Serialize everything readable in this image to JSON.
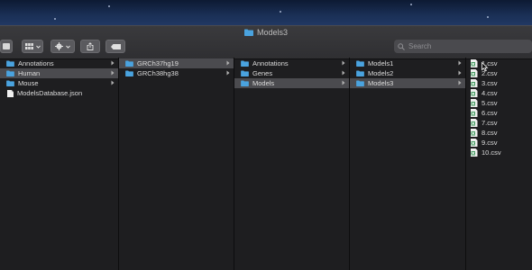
{
  "window": {
    "title": "Models3"
  },
  "toolbar": {
    "search_placeholder": "Search",
    "buttons": [
      "sidebar-toggle-button",
      "view-options-button",
      "action-gear-button",
      "share-button",
      "tag-button"
    ]
  },
  "columns": [
    {
      "items": [
        {
          "label": "Annotations",
          "type": "folder",
          "chevron": true,
          "selected": false
        },
        {
          "label": "Human",
          "type": "folder",
          "chevron": true,
          "selected": true
        },
        {
          "label": "Mouse",
          "type": "folder",
          "chevron": true,
          "selected": false
        },
        {
          "label": "ModelsDatabase.json",
          "type": "file",
          "chevron": false,
          "selected": false
        }
      ]
    },
    {
      "items": [
        {
          "label": "GRCh37hg19",
          "type": "folder",
          "chevron": true,
          "selected": true
        },
        {
          "label": "GRCh38hg38",
          "type": "folder",
          "chevron": true,
          "selected": false
        }
      ]
    },
    {
      "items": [
        {
          "label": "Annotations",
          "type": "folder",
          "chevron": true,
          "selected": false
        },
        {
          "label": "Genes",
          "type": "folder",
          "chevron": true,
          "selected": false
        },
        {
          "label": "Models",
          "type": "folder",
          "chevron": true,
          "selected": true
        }
      ]
    },
    {
      "items": [
        {
          "label": "Models1",
          "type": "folder",
          "chevron": true,
          "selected": false
        },
        {
          "label": "Models2",
          "type": "folder",
          "chevron": true,
          "selected": false
        },
        {
          "label": "Models3",
          "type": "folder",
          "chevron": true,
          "selected": true
        }
      ]
    },
    {
      "items": [
        {
          "label": "1.csv",
          "type": "csv"
        },
        {
          "label": "2.csv",
          "type": "csv"
        },
        {
          "label": "3.csv",
          "type": "csv"
        },
        {
          "label": "4.csv",
          "type": "csv"
        },
        {
          "label": "5.csv",
          "type": "csv"
        },
        {
          "label": "6.csv",
          "type": "csv"
        },
        {
          "label": "7.csv",
          "type": "csv"
        },
        {
          "label": "8.csv",
          "type": "csv"
        },
        {
          "label": "9.csv",
          "type": "csv"
        },
        {
          "label": "10.csv",
          "type": "csv"
        }
      ]
    }
  ],
  "colors": {
    "folder": "#4aa3df",
    "selection": "#4b4b4f",
    "csv_icon": "#2f8f4e"
  }
}
